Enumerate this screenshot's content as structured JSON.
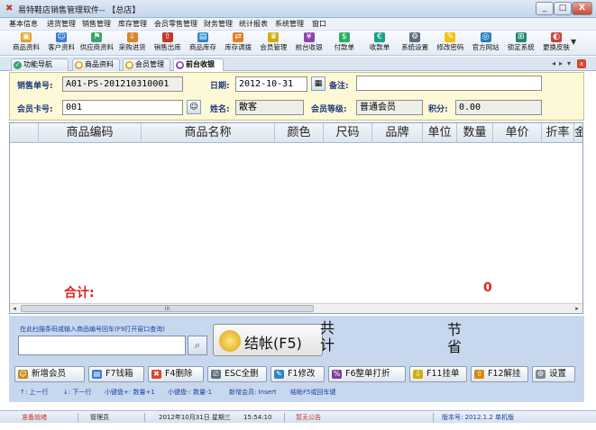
{
  "window": {
    "title": "易特鞋店销售管理软件-- 【总店】",
    "minimize": "_",
    "maximize": "□",
    "close": "X"
  },
  "menu": [
    "基本信息",
    "进货管理",
    "销售管理",
    "库存管理",
    "会员零售管理",
    "财务管理",
    "统计报表",
    "系统管理",
    "窗口"
  ],
  "toolbar": {
    "items": [
      {
        "label": "商品资料",
        "icon": "product-icon",
        "color": "#e6a11d"
      },
      {
        "label": "客户资料",
        "icon": "customer-icon",
        "color": "#3a7bd5"
      },
      {
        "label": "供应商资料",
        "icon": "supplier-icon",
        "color": "#3aa56a"
      },
      {
        "label": "采购进货",
        "icon": "purchase-icon",
        "color": "#d9852b"
      },
      {
        "label": "销售出库",
        "icon": "sales-out-icon",
        "color": "#c0392b"
      },
      {
        "label": "商品库存",
        "icon": "stock-icon",
        "color": "#2e86c1"
      },
      {
        "label": "库存调拨",
        "icon": "transfer-icon",
        "color": "#e67e22"
      },
      {
        "label": "会员管理",
        "icon": "member-icon",
        "color": "#d4ac0d"
      },
      {
        "label": "前台收银",
        "icon": "cashier-icon",
        "color": "#8e44ad"
      },
      {
        "label": "付款单",
        "icon": "payment-icon",
        "color": "#27ae60"
      },
      {
        "label": "收款单",
        "icon": "receipt-icon",
        "color": "#16a085"
      },
      {
        "label": "系统设置",
        "icon": "settings-icon",
        "color": "#5d6d7e"
      },
      {
        "label": "修改密码",
        "icon": "password-icon",
        "color": "#f1c40f"
      },
      {
        "label": "官方网站",
        "icon": "website-icon",
        "color": "#2980b9"
      },
      {
        "label": "锁定系统",
        "icon": "lock-icon",
        "color": "#1f8a70"
      },
      {
        "label": "更换皮肤",
        "icon": "skin-icon",
        "color": "#cb4335"
      }
    ],
    "more": "▼"
  },
  "tabs": [
    {
      "label": "功能导航",
      "icon": "nav-icon",
      "color": "#3aa56a",
      "active": false
    },
    {
      "label": "商品资料",
      "icon": "product-tab-icon",
      "color": "#e6a11d",
      "active": false
    },
    {
      "label": "会员管理",
      "icon": "member-tab-icon",
      "color": "#d4ac0d",
      "active": false
    },
    {
      "label": "前台收银",
      "icon": "cashier-tab-icon",
      "color": "#8e44ad",
      "active": true
    }
  ],
  "tab_nav": {
    "prev": "◂",
    "next": "▸",
    "pin": "▾",
    "close": "x"
  },
  "form": {
    "order_no_label": "销售单号:",
    "order_no": "A01-PS-201210310001",
    "date_label": "日期:",
    "date": "2012-10-31",
    "remark_label": "备注:",
    "remark": "",
    "card_label": "会员卡号:",
    "card": "001",
    "name_label": "姓名:",
    "name": "散客",
    "level_label": "会员等级:",
    "level": "普通会员",
    "points_label": "积分:",
    "points": "0.00"
  },
  "grid": {
    "columns": [
      "",
      "商品编码",
      "商品名称",
      "颜色",
      "尺码",
      "品牌",
      "单位",
      "数量",
      "单价",
      "折率",
      "金"
    ],
    "total_label": "合计:",
    "total_value": "0",
    "scroll_thumb": "III"
  },
  "checkout": {
    "scan_hint": "在此扫描条码或输入商品编号回车(F9打开窗口查询)",
    "scan_value": "",
    "button_label": "结帐(F5)",
    "total_word_1": "共",
    "total_word_2": "计",
    "save_word_1": "节",
    "save_word_2": "省"
  },
  "function_buttons": [
    {
      "label": "新增会员",
      "icon": "add-member-icon",
      "color": "#c98a1d"
    },
    {
      "label": "F7钱箱",
      "icon": "cashbox-icon",
      "color": "#3a7bd5"
    },
    {
      "label": "F4删除",
      "icon": "delete-icon",
      "color": "#d9452c"
    },
    {
      "label": "ESC全删",
      "icon": "clear-all-icon",
      "color": "#5d6d7e"
    },
    {
      "label": "F1修改",
      "icon": "edit-icon",
      "color": "#2e86c1"
    },
    {
      "label": "F6整单打折",
      "icon": "discount-icon",
      "color": "#7d3c98"
    },
    {
      "label": "F11挂单",
      "icon": "hold-order-icon",
      "color": "#d4ac0d"
    },
    {
      "label": "F12解挂",
      "icon": "release-order-icon",
      "color": "#d68910"
    },
    {
      "label": "设置",
      "icon": "gear-icon",
      "color": "#7f8c8d"
    }
  ],
  "hints": [
    "↑: 上一行",
    "↓: 下一行",
    "小键盘+: 数量+1",
    "小键盘-: 数量-1",
    "新增会员: Insert",
    "结帐F5或回车键"
  ],
  "status": {
    "ready": "准备就绪",
    "user": "管理员",
    "datetime": "2012年10月31日 星期三",
    "time": "15:54:10",
    "notice": "暂无公告",
    "version": "版本号: 2012.1.2 单机版"
  }
}
